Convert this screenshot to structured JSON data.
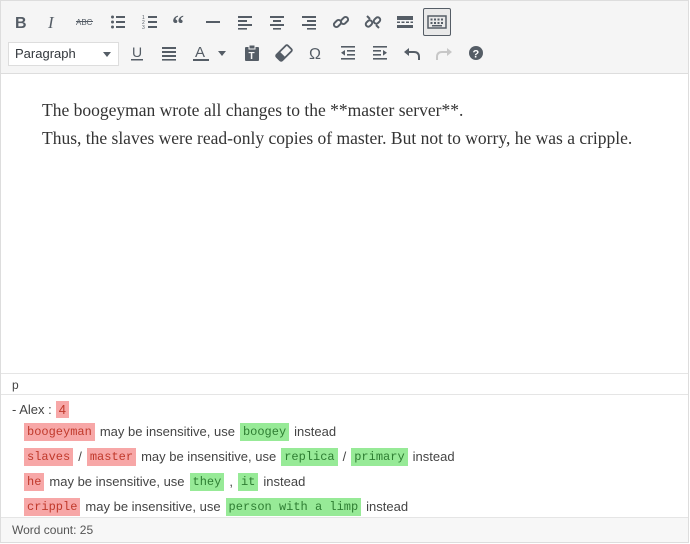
{
  "toolbar": {
    "row1": [
      {
        "name": "bold-icon",
        "title": "Bold"
      },
      {
        "name": "italic-icon",
        "title": "Italic"
      },
      {
        "name": "strikethrough-icon",
        "title": "Strikethrough"
      },
      {
        "name": "bulleted-list-icon",
        "title": "Bulleted list"
      },
      {
        "name": "numbered-list-icon",
        "title": "Numbered list"
      },
      {
        "name": "blockquote-icon",
        "title": "Blockquote"
      },
      {
        "name": "horizontal-line-icon",
        "title": "Horizontal line"
      },
      {
        "name": "align-left-icon",
        "title": "Align left"
      },
      {
        "name": "align-center-icon",
        "title": "Align center"
      },
      {
        "name": "align-right-icon",
        "title": "Align right"
      },
      {
        "name": "insert-link-icon",
        "title": "Insert/edit link"
      },
      {
        "name": "remove-link-icon",
        "title": "Remove link"
      },
      {
        "name": "read-more-icon",
        "title": "Insert Read More tag"
      },
      {
        "name": "toolbar-toggle-icon",
        "title": "Toolbar Toggle"
      }
    ],
    "format_select": "Paragraph",
    "row2": [
      {
        "name": "underline-icon",
        "title": "Underline"
      },
      {
        "name": "justify-icon",
        "title": "Justify"
      },
      {
        "name": "text-color-icon",
        "title": "Text color"
      },
      {
        "name": "paste-text-icon",
        "title": "Paste as text"
      },
      {
        "name": "clear-formatting-icon",
        "title": "Clear formatting"
      },
      {
        "name": "special-character-icon",
        "title": "Special character"
      },
      {
        "name": "decrease-indent-icon",
        "title": "Decrease indent"
      },
      {
        "name": "increase-indent-icon",
        "title": "Increase indent"
      },
      {
        "name": "undo-icon",
        "title": "Undo"
      },
      {
        "name": "redo-icon",
        "title": "Redo"
      },
      {
        "name": "help-icon",
        "title": "Keyboard Shortcuts"
      }
    ]
  },
  "content": {
    "line1": "The boogeyman wrote all changes to the **master server**.",
    "line2": "Thus, the slaves were read-only copies of master. But not to worry, he was a cripple."
  },
  "path": "p",
  "alex": {
    "label": "- Alex :",
    "count": "4",
    "messages": [
      {
        "bad": [
          "boogeyman"
        ],
        "text": "may be insensitive, use",
        "good": [
          "boogey"
        ],
        "suffix": "instead"
      },
      {
        "bad": [
          "slaves",
          "master"
        ],
        "text": "may be insensitive, use",
        "good": [
          "replica",
          "primary"
        ],
        "suffix": "instead"
      },
      {
        "bad": [
          "he"
        ],
        "text": "may be insensitive, use",
        "good": [
          "they",
          "it"
        ],
        "suffix": "instead"
      },
      {
        "bad": [
          "cripple"
        ],
        "text": "may be insensitive, use",
        "good": [
          "person with a limp"
        ],
        "suffix": "instead"
      }
    ],
    "separators": {
      "slash": "/",
      "comma": ","
    }
  },
  "status": {
    "word_count": "Word count: 25"
  },
  "colors": {
    "bad_bg": "#f7a7a7",
    "bad_fg": "#c0392b",
    "good_bg": "#97ea97",
    "good_fg": "#2e7d32"
  }
}
